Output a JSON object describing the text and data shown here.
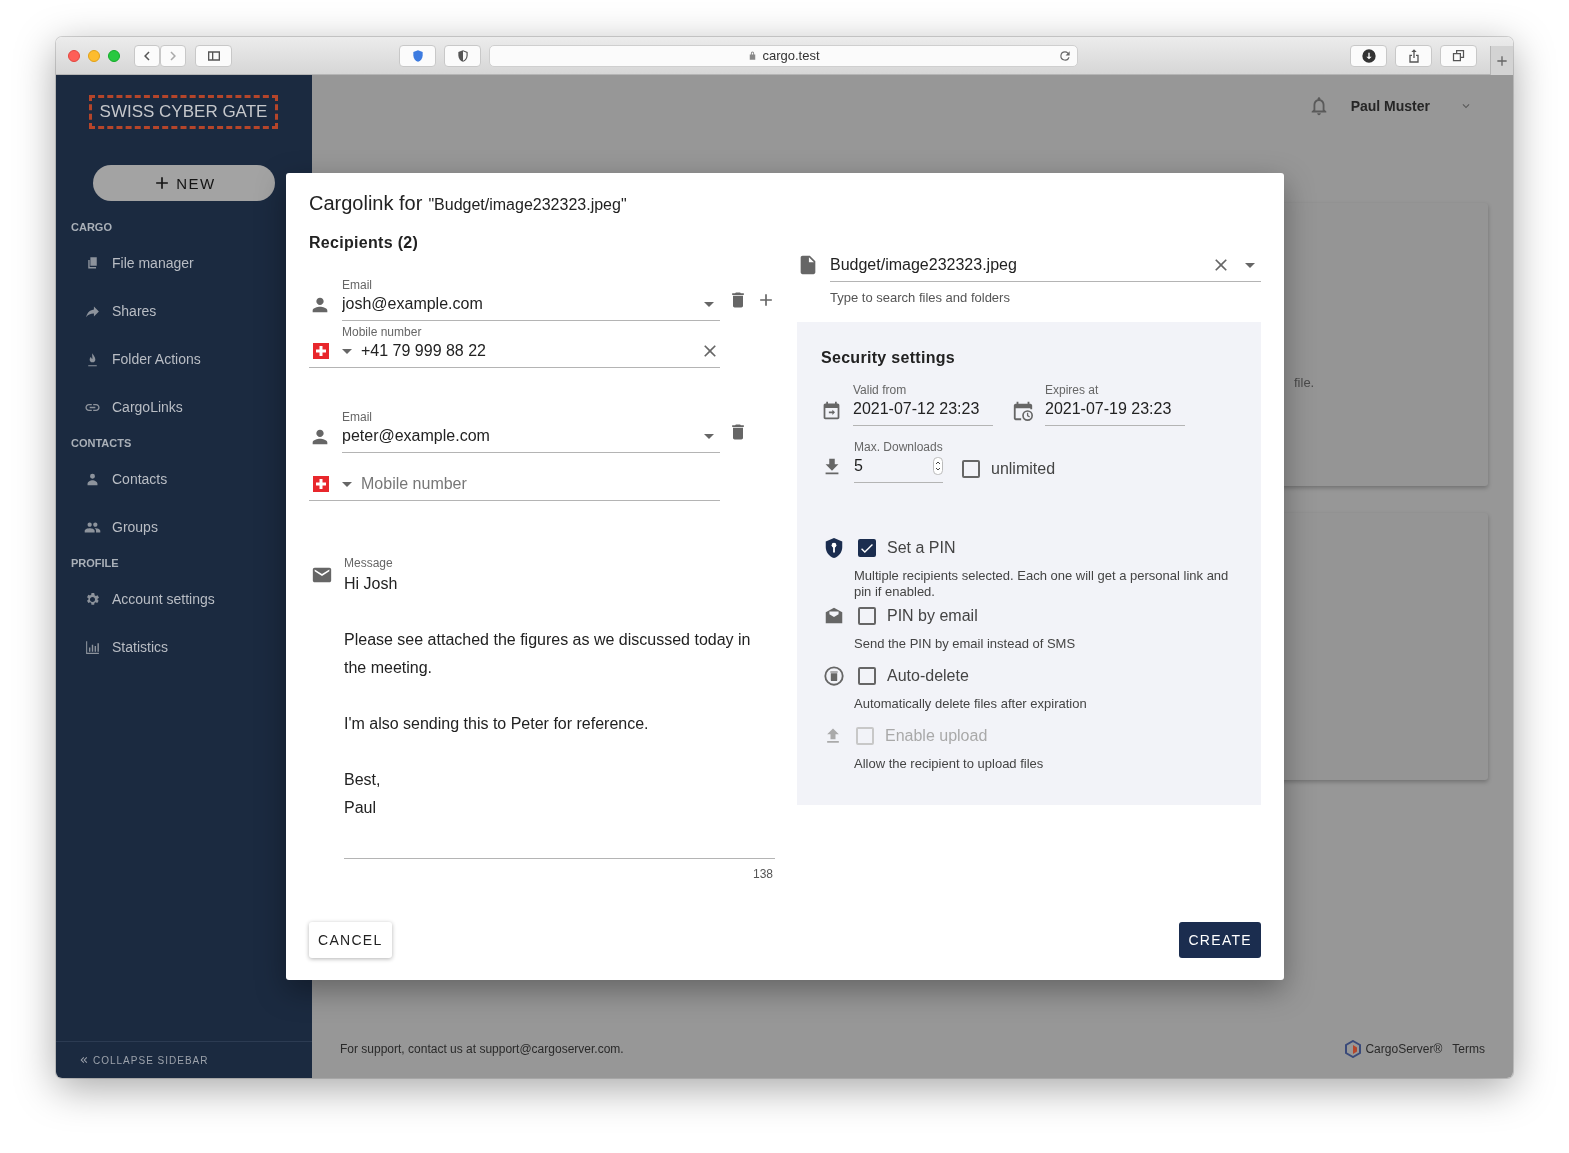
{
  "browser": {
    "url": "cargo.test"
  },
  "sidebar": {
    "logo": "SWISS CYBER GATE",
    "new_button": "NEW",
    "sections": [
      {
        "heading": "CARGO",
        "items": [
          {
            "label": "File manager"
          },
          {
            "label": "Shares"
          },
          {
            "label": "Folder Actions"
          },
          {
            "label": "CargoLinks"
          }
        ]
      },
      {
        "heading": "CONTACTS",
        "items": [
          {
            "label": "Contacts"
          },
          {
            "label": "Groups"
          }
        ]
      },
      {
        "heading": "PROFILE",
        "items": [
          {
            "label": "Account settings"
          },
          {
            "label": "Statistics"
          }
        ]
      }
    ],
    "collapse": "COLLAPSE SIDEBAR"
  },
  "header": {
    "user": "Paul Muster"
  },
  "background_card": {
    "text": "file."
  },
  "footer": {
    "support": "For support, contact us at support@cargoserver.com.",
    "brand": "CargoServer®",
    "terms": "Terms"
  },
  "dialog": {
    "title": "Cargolink for",
    "file_name": "\"Budget/image232323.jpeg\"",
    "recipients_heading": "Recipients (2)",
    "recipients": [
      {
        "email_label": "Email",
        "email": "josh@example.com",
        "mobile_label": "Mobile number",
        "mobile": "+41 79 999 88 22"
      },
      {
        "email_label": "Email",
        "email": "peter@example.com",
        "mobile_placeholder": "Mobile number"
      }
    ],
    "message": {
      "label": "Message",
      "value": "Hi Josh\n\nPlease see attached the figures as we discussed today in the meeting.\n\nI'm also sending this to Peter for reference.\n\nBest,\nPaul",
      "counter": "138"
    },
    "file": {
      "value": "Budget/image232323.jpeg",
      "helper": "Type to search files and folders"
    },
    "security": {
      "heading": "Security settings",
      "valid_from": {
        "label": "Valid from",
        "value": "2021-07-12 23:23"
      },
      "expires_at": {
        "label": "Expires at",
        "value": "2021-07-19 23:23"
      },
      "max_downloads": {
        "label": "Max. Downloads",
        "value": "5"
      },
      "unlimited": {
        "label": "unlimited",
        "checked": false
      },
      "options": [
        {
          "label": "Set a PIN",
          "description": "Multiple recipients selected. Each one will get a personal link and pin if enabled.",
          "checked": true,
          "disabled": false
        },
        {
          "label": "PIN by email",
          "description": "Send the PIN by email instead of SMS",
          "checked": false,
          "disabled": false
        },
        {
          "label": "Auto-delete",
          "description": "Automatically delete files after expiration",
          "checked": false,
          "disabled": false
        },
        {
          "label": "Enable upload",
          "description": "Allow the recipient to upload files",
          "checked": false,
          "disabled": true
        }
      ]
    },
    "buttons": {
      "cancel": "CANCEL",
      "create": "CREATE"
    }
  }
}
